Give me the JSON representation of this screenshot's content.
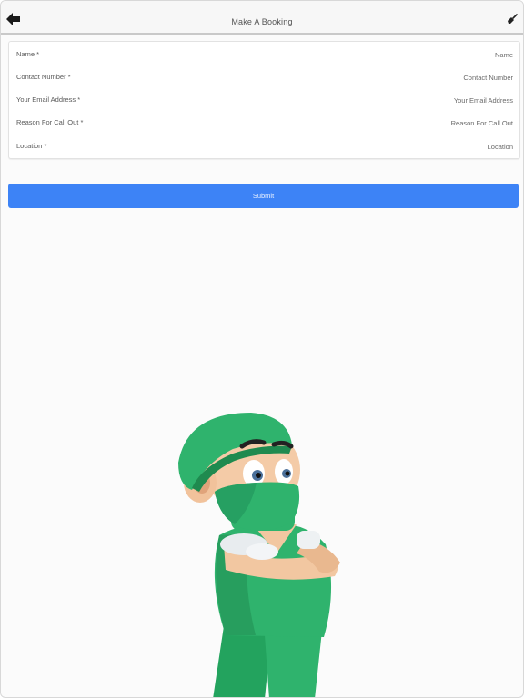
{
  "header": {
    "title": "Make A Booking",
    "back_icon": "back-arrow-icon",
    "action_icon": "broom-icon"
  },
  "form": {
    "fields": [
      {
        "label": "Name *",
        "placeholder": "Name",
        "value": ""
      },
      {
        "label": "Contact Number *",
        "placeholder": "Contact Number",
        "value": ""
      },
      {
        "label": "Your Email Address *",
        "placeholder": "Your Email Address",
        "value": ""
      },
      {
        "label": "Reason For Call Out *",
        "placeholder": "Reason For Call Out",
        "value": ""
      },
      {
        "label": "Location *",
        "placeholder": "Location",
        "value": ""
      }
    ],
    "submit_label": "Submit"
  },
  "colors": {
    "accent": "#3d83f6",
    "scrubs": "#2fb36d",
    "scrubs_dark": "#1f8a4f"
  }
}
